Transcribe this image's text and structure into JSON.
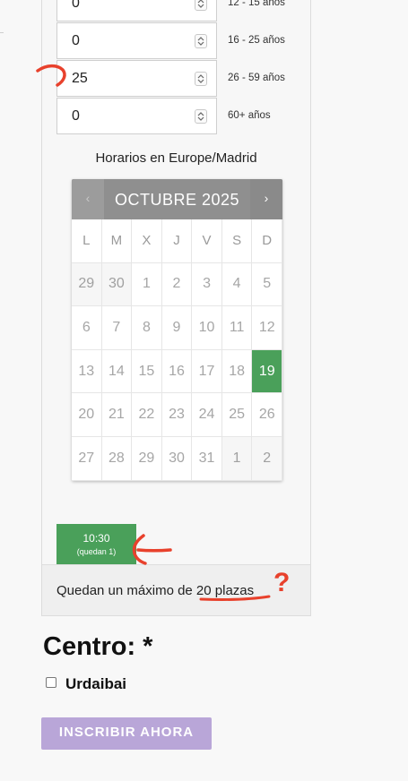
{
  "quantities": [
    {
      "value": "0",
      "label": "12 - 15 años"
    },
    {
      "value": "0",
      "label": "16 - 25 años"
    },
    {
      "value": "25",
      "label": "26 - 59 años"
    },
    {
      "value": "0",
      "label": "60+ años"
    }
  ],
  "timezone_label": "Horarios en Europe/Madrid",
  "calendar": {
    "prev": "‹",
    "next": "›",
    "title": "OCTUBRE 2025",
    "weekdays": [
      "L",
      "M",
      "X",
      "J",
      "V",
      "S",
      "D"
    ],
    "days": [
      {
        "d": "29",
        "other": true
      },
      {
        "d": "30",
        "other": true
      },
      {
        "d": "1"
      },
      {
        "d": "2"
      },
      {
        "d": "3"
      },
      {
        "d": "4"
      },
      {
        "d": "5"
      },
      {
        "d": "6"
      },
      {
        "d": "7"
      },
      {
        "d": "8"
      },
      {
        "d": "9"
      },
      {
        "d": "10"
      },
      {
        "d": "11"
      },
      {
        "d": "12"
      },
      {
        "d": "13"
      },
      {
        "d": "14"
      },
      {
        "d": "15"
      },
      {
        "d": "16"
      },
      {
        "d": "17"
      },
      {
        "d": "18"
      },
      {
        "d": "19",
        "selected": true
      },
      {
        "d": "20"
      },
      {
        "d": "21"
      },
      {
        "d": "22"
      },
      {
        "d": "23"
      },
      {
        "d": "24"
      },
      {
        "d": "25"
      },
      {
        "d": "26"
      },
      {
        "d": "27"
      },
      {
        "d": "28"
      },
      {
        "d": "29"
      },
      {
        "d": "30"
      },
      {
        "d": "31"
      },
      {
        "d": "1",
        "other": true
      },
      {
        "d": "2",
        "other": true
      }
    ]
  },
  "slot": {
    "time": "10:30",
    "remaining": "(quedan 1)"
  },
  "info": "Quedan un máximo de 20 plazas",
  "centro_heading": "Centro: *",
  "centro_option": "Urdaibai",
  "submit": "INSCRIBIR AHORA",
  "annotation": {
    "mark": "?"
  },
  "colors": {
    "selected": "#4aa05a",
    "header": "#8f8f8f",
    "button": "#b9a6d8",
    "annotation": "#e8412c"
  }
}
